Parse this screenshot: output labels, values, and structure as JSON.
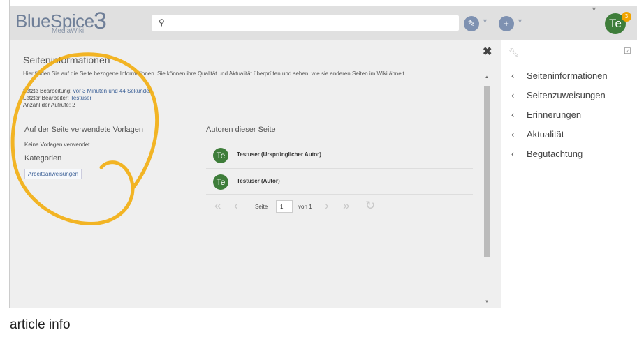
{
  "logo": {
    "text": "BlueSpice",
    "sub": "MediaWiki",
    "num": "3"
  },
  "search": {
    "icon": "search-icon",
    "value": ""
  },
  "toolbar": {
    "edit_icon": "pencil-icon",
    "add_icon": "plus-icon"
  },
  "user": {
    "initials": "Te",
    "notifications": "3"
  },
  "main": {
    "title": "Seiteninformationen",
    "description": "Hier finden Sie auf die Seite bezogene Informationen. Sie können ihre Qualität und Aktualität überprüfen und sehen, wie sie anderen Seiten im Wiki ähnelt.",
    "last_edit_label": "Letzte Bearbeitung:",
    "last_edit_value": "vor 3 Minuten und 44 Sekunden",
    "last_editor_label": "Letzter Bearbeiter:",
    "last_editor_value": "Testuser",
    "views_label": "Anzahl der Aufrufe: 2",
    "templates_heading": "Auf der Seite verwendete Vorlagen",
    "templates_empty": "Keine Vorlagen verwendet",
    "categories_heading": "Kategorien",
    "category_tag": "Arbeitsanweisungen",
    "authors_heading": "Autoren dieser Seite",
    "authors": [
      {
        "initials": "Te",
        "name": "Testuser (Ursprünglicher Autor)"
      },
      {
        "initials": "Te",
        "name": "Testuser (Autor)"
      }
    ],
    "pager": {
      "page_label": "Seite",
      "page_value": "1",
      "of_label": "von 1"
    }
  },
  "rightpanel": {
    "items": [
      {
        "label": "Seiteninformationen"
      },
      {
        "label": "Seitenzuweisungen"
      },
      {
        "label": "Erinnerungen"
      },
      {
        "label": "Aktualität"
      },
      {
        "label": "Begutachtung"
      }
    ]
  },
  "caption": "article info",
  "colors": {
    "highlight": "#f2a900",
    "accent": "#3a5f96",
    "avatar": "#3e7d3a",
    "badge": "#f1a400"
  }
}
